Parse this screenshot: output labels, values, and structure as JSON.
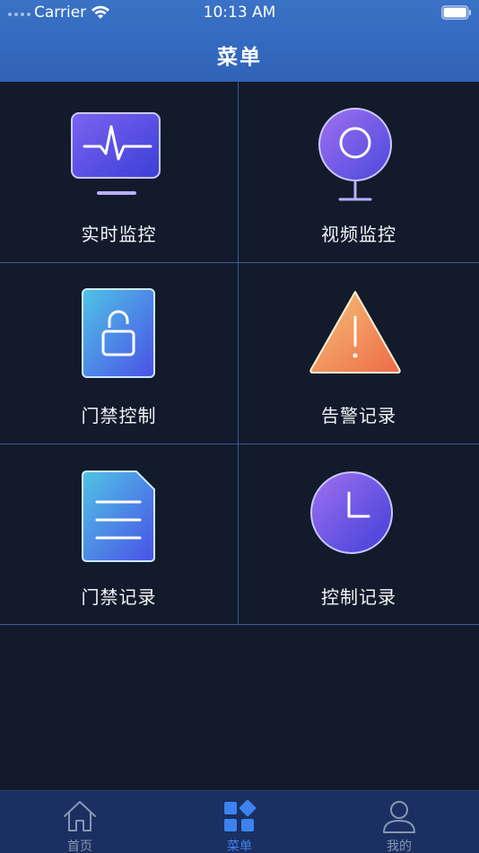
{
  "status_bar": {
    "carrier": "Carrier",
    "time": "10:13 AM"
  },
  "header": {
    "title": "菜单"
  },
  "menu": {
    "items": [
      {
        "label": "实时监控",
        "icon": "monitor-pulse-icon"
      },
      {
        "label": "视频监控",
        "icon": "webcam-icon"
      },
      {
        "label": "门禁控制",
        "icon": "unlock-icon"
      },
      {
        "label": "告警记录",
        "icon": "warning-icon"
      },
      {
        "label": "门禁记录",
        "icon": "document-icon"
      },
      {
        "label": "控制记录",
        "icon": "clock-icon"
      }
    ]
  },
  "tabbar": {
    "tabs": [
      {
        "label": "首页",
        "icon": "home-icon",
        "active": false
      },
      {
        "label": "菜单",
        "icon": "grid-menu-icon",
        "active": true
      },
      {
        "label": "我的",
        "icon": "user-icon",
        "active": false
      }
    ]
  },
  "colors": {
    "header": "#2f63b8",
    "background": "#121a2b",
    "tabbar": "#1b2f63",
    "active_tab": "#3d82ee",
    "inactive_tab": "#8a96b0"
  }
}
